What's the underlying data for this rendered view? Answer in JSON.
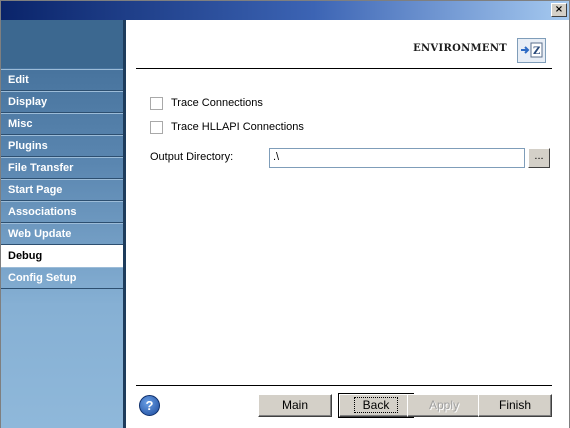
{
  "window": {
    "close_glyph": "×"
  },
  "sidebar": {
    "items": [
      {
        "label": "Edit"
      },
      {
        "label": "Display"
      },
      {
        "label": "Misc"
      },
      {
        "label": "Plugins"
      },
      {
        "label": "File Transfer"
      },
      {
        "label": "Start Page"
      },
      {
        "label": "Associations"
      },
      {
        "label": "Web Update"
      },
      {
        "label": "Debug",
        "selected": true
      },
      {
        "label": "Config Setup"
      }
    ]
  },
  "header": {
    "title": "ENVIRONMENT",
    "icon": "environment-icon"
  },
  "options": {
    "trace_connections": {
      "label": "Trace Connections",
      "checked": false
    },
    "trace_hllapi": {
      "label": "Trace HLLAPI Connections",
      "checked": false
    }
  },
  "output_directory": {
    "label": "Output Directory:",
    "value": ".\\",
    "browse_label": "..."
  },
  "footer": {
    "help_glyph": "?",
    "main_label": "Main",
    "back_label": "Back",
    "apply_label": "Apply",
    "finish_label": "Finish"
  },
  "colors": {
    "accent": "#0a246a",
    "sidebar": "#5a86b0",
    "selected": "#ffffff"
  }
}
